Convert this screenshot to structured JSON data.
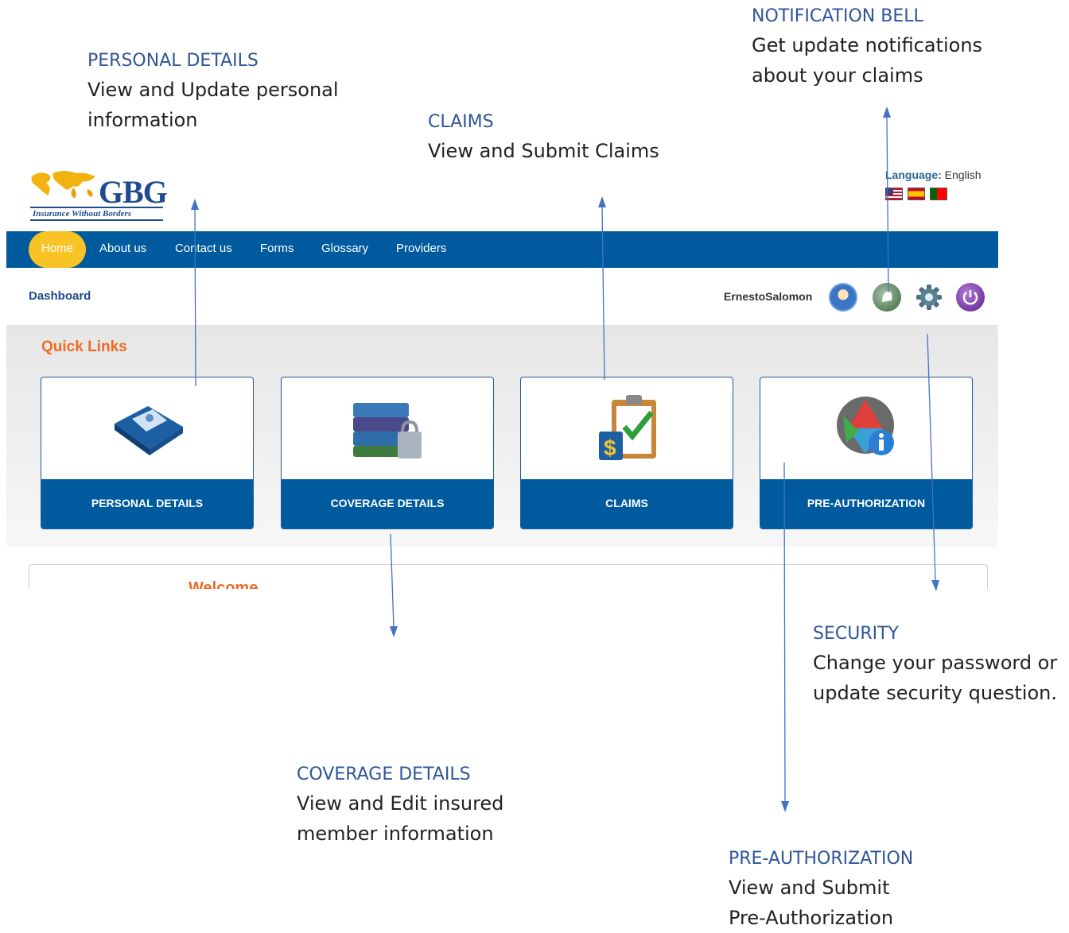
{
  "annotations": {
    "personal": {
      "title": "PERSONAL DETAILS",
      "desc1": "View and Update personal",
      "desc2": "information"
    },
    "claims": {
      "title": "CLAIMS",
      "desc1": "View and Submit Claims"
    },
    "bell": {
      "title": "NOTIFICATION BELL",
      "desc1": "Get update notifications",
      "desc2": "about your claims"
    },
    "security": {
      "title": "SECURITY",
      "desc1": "Change your password or",
      "desc2": "update security question."
    },
    "coverage": {
      "title": "COVERAGE DETAILS",
      "desc1": "View and Edit insured",
      "desc2": "member information"
    },
    "preauth": {
      "title": "PRE-AUTHORIZATION",
      "desc1": "View and Submit",
      "desc2": "Pre-Authorization"
    }
  },
  "brand": {
    "logo": "GBG",
    "tagline": "Insurance Without Borders"
  },
  "language": {
    "label": "Language:",
    "value": "English"
  },
  "nav": {
    "home": "Home",
    "about": "About us",
    "contact": "Contact us",
    "forms": "Forms",
    "glossary": "Glossary",
    "providers": "Providers"
  },
  "breadcrumb": "Dashboard",
  "user": {
    "name": "ErnestoSalomon"
  },
  "quick_links": {
    "title": "Quick Links",
    "cards": [
      {
        "label": "PERSONAL DETAILS",
        "icon": "address-book-icon"
      },
      {
        "label": "COVERAGE DETAILS",
        "icon": "books-lock-icon"
      },
      {
        "label": "CLAIMS",
        "icon": "clipboard-dollar-icon"
      },
      {
        "label": "PRE-AUTHORIZATION",
        "icon": "info-globe-icon"
      }
    ]
  },
  "welcome": "Welcome",
  "colors": {
    "nav": "#005a9e",
    "accent": "#ee6a24",
    "home_pill": "#f7c325",
    "annotation": "#2f5597"
  }
}
